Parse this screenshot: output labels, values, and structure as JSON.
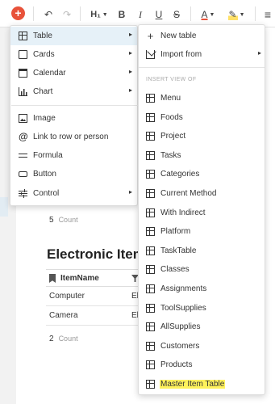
{
  "toolbar": {
    "add": "+",
    "undo": "↶",
    "redo": "↷",
    "heading": "H₁",
    "heading_caret": "▼",
    "bold": "B",
    "italic": "I",
    "underline": "U",
    "strike": "S",
    "text_color": "A",
    "text_color_caret": "▼",
    "highlight": "✎",
    "highlight_caret": "▼",
    "align": "≡"
  },
  "doc": {
    "count1_value": "5",
    "count1_label": "Count",
    "section_title": "Electronic Items",
    "table": {
      "header": "ItemName",
      "rows": [
        {
          "c1": "Computer",
          "c2": "El"
        },
        {
          "c1": "Camera",
          "c2": "El"
        }
      ]
    },
    "count2_value": "2",
    "count2_label": "Count"
  },
  "menu": {
    "items": [
      {
        "label": "Table",
        "icon": "table-icon",
        "submenu": true,
        "active": true
      },
      {
        "label": "Cards",
        "icon": "cards-icon",
        "submenu": true
      },
      {
        "label": "Calendar",
        "icon": "calendar-icon",
        "submenu": true
      },
      {
        "label": "Chart",
        "icon": "chart-icon",
        "submenu": true
      },
      {
        "label": "Image",
        "icon": "image-icon"
      },
      {
        "label": "Link to row or person",
        "icon": "at-icon"
      },
      {
        "label": "Formula",
        "icon": "equals-icon"
      },
      {
        "label": "Button",
        "icon": "button-icon"
      },
      {
        "label": "Control",
        "icon": "sliders-icon",
        "submenu": true
      }
    ],
    "arrow": "▸"
  },
  "submenu": {
    "new_table": "New table",
    "import_from": "Import from",
    "section_header": "INSERT VIEW OF",
    "views": [
      "Menu",
      "Foods",
      "Project",
      "Tasks",
      "Categories",
      "Current Method",
      "With Indirect",
      "Platform",
      "TaskTable",
      "Classes",
      "Assignments",
      "ToolSupplies",
      "AllSupplies",
      "Customers",
      "Products",
      "Master Item Table"
    ],
    "highlight_color": "#fff25c"
  },
  "colors": {
    "accent": "#e8523a",
    "active_row": "#e6f1f8"
  }
}
